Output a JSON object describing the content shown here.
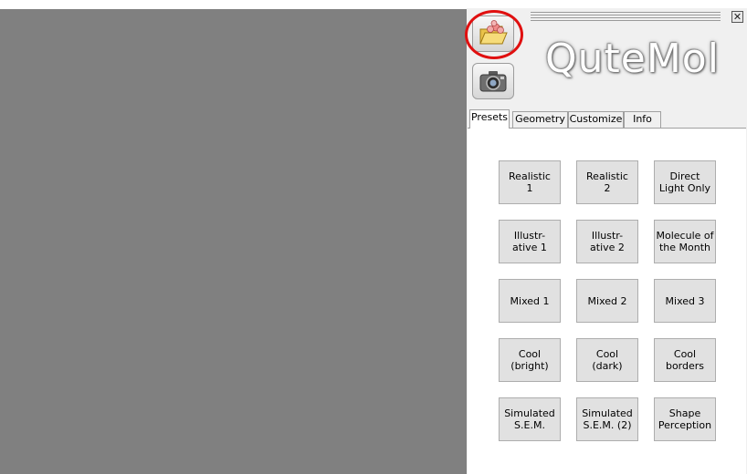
{
  "panel": {
    "close_glyph": "✕",
    "logo_text": "QuteMol",
    "toolbar": {
      "open_icon": "open-molecule-folder-icon",
      "snapshot_icon": "camera-icon"
    }
  },
  "tabs": [
    "Presets",
    "Geometry",
    "Customize",
    "Info"
  ],
  "active_tab": "Presets",
  "presets": [
    [
      "Realistic\n1",
      "Realistic\n2",
      "Direct\nLight Only"
    ],
    [
      "Illustr-\native 1",
      "Illustr-\native 2",
      "Molecule of\nthe Month"
    ],
    [
      "Mixed 1",
      "Mixed 2",
      "Mixed 3"
    ],
    [
      "Cool\n(bright)",
      "Cool\n(dark)",
      "Cool\nborders"
    ],
    [
      "Simulated\nS.E.M.",
      "Simulated\nS.E.M. (2)",
      "Shape\nPerception"
    ]
  ],
  "colors": {
    "viewport": "#808080",
    "highlight": "#e01010"
  }
}
